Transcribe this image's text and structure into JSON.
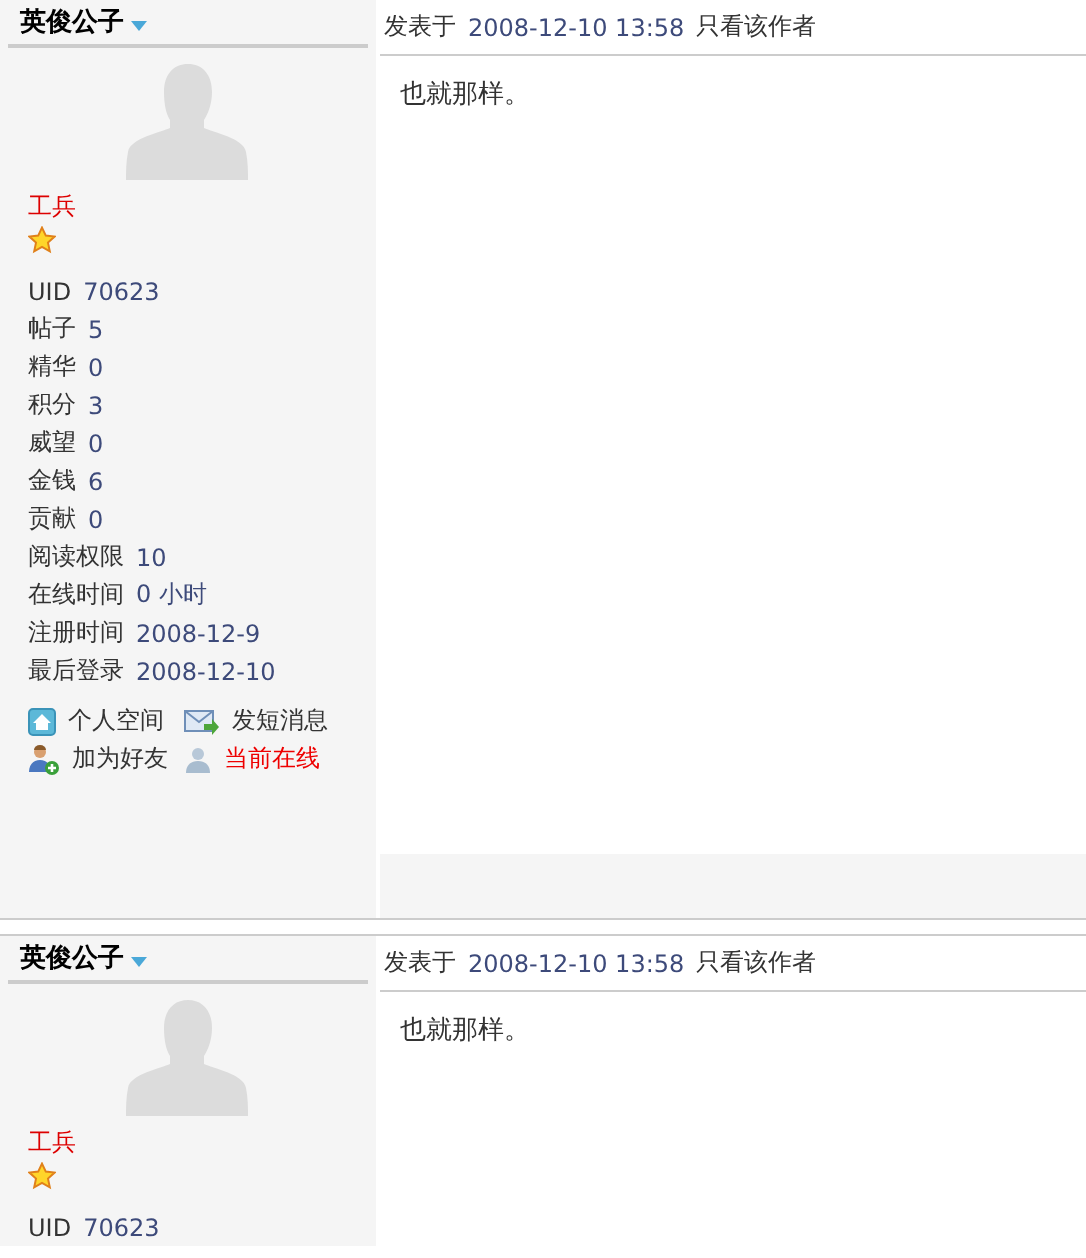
{
  "posts": [
    {
      "author": {
        "name": "英俊公子",
        "rank": "工兵",
        "stats": [
          {
            "label": "UID",
            "value": "70623"
          },
          {
            "label": "帖子",
            "value": "5"
          },
          {
            "label": "精华",
            "value": "0"
          },
          {
            "label": "积分",
            "value": "3"
          },
          {
            "label": "威望",
            "value": "0"
          },
          {
            "label": "金钱",
            "value": "6"
          },
          {
            "label": "贡献",
            "value": "0"
          },
          {
            "label": "阅读权限",
            "value": "10"
          },
          {
            "label": "在线时间",
            "value": "0 小时"
          },
          {
            "label": "注册时间",
            "value": "2008-12-9"
          },
          {
            "label": "最后登录",
            "value": "2008-12-10"
          }
        ],
        "actions": [
          {
            "label": "个人空间",
            "kind": "home"
          },
          {
            "label": "发短消息",
            "kind": "message"
          },
          {
            "label": "加为好友",
            "kind": "friend"
          },
          {
            "label": "当前在线",
            "kind": "online"
          }
        ]
      },
      "meta": {
        "posted_label": "发表于",
        "time": "2008-12-10 13:58",
        "author_only_link": "只看该作者"
      },
      "content": "也就那样。"
    },
    {
      "author": {
        "name": "英俊公子",
        "rank": "工兵",
        "stats": [
          {
            "label": "UID",
            "value": "70623"
          }
        ]
      },
      "meta": {
        "posted_label": "发表于",
        "time": "2008-12-10 13:58",
        "author_only_link": "只看该作者"
      },
      "content": "也就那样。"
    }
  ]
}
